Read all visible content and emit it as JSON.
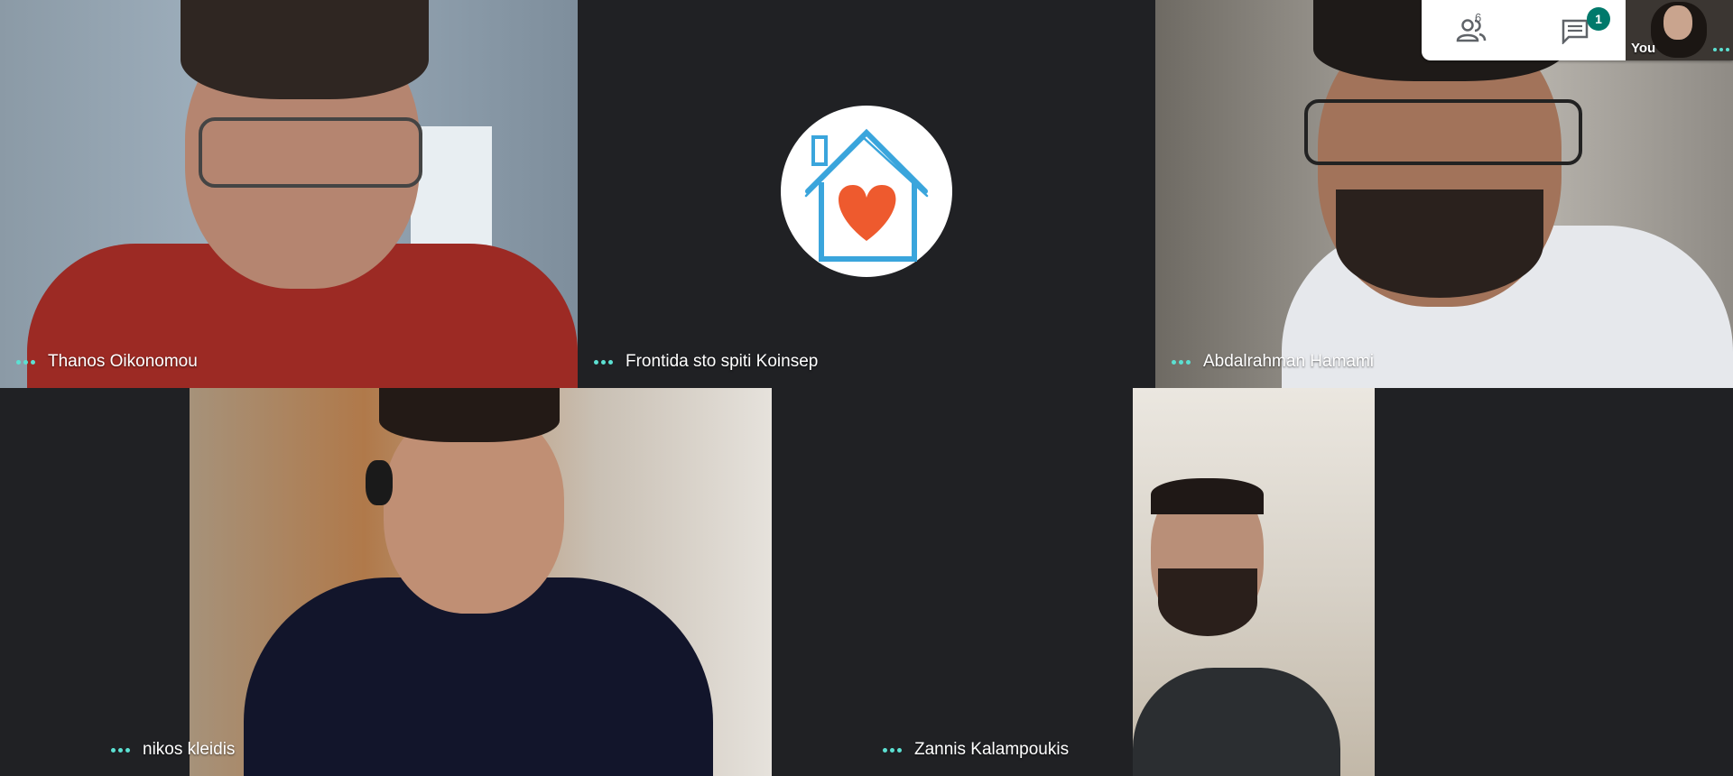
{
  "participants": {
    "p1": {
      "name": "Thanos Oikonomou"
    },
    "p2": {
      "name": "Frontida sto spiti Koinsep"
    },
    "p3": {
      "name": "Abdalrahman Hamami"
    },
    "p4": {
      "name": "nikos kleidis"
    },
    "p5": {
      "name": "Zannis Kalampoukis"
    }
  },
  "controls": {
    "participants_count": "6",
    "chat_badge": "1",
    "self_label": "You"
  },
  "colors": {
    "background": "#202124",
    "dots": "#5ce0d2",
    "badge": "#00796b",
    "logo_house": "#3aa5dc",
    "logo_heart": "#ee5a2e"
  },
  "icons": {
    "participants": "people-icon",
    "chat": "chat-icon",
    "more": "more-options-icon"
  }
}
